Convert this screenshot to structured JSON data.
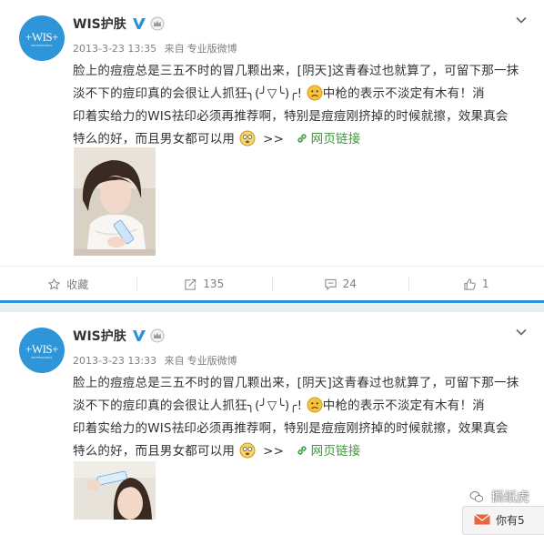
{
  "posts": [
    {
      "author": "WIS护肤",
      "avatar_text": "+WIS+",
      "avatar_sub": "PROFESSIONAL",
      "date": "2013-3-23 13:35",
      "source_prefix": "来自",
      "source": "专业版微博",
      "text_line1": "脸上的痘痘总是三五不时的冒几颗出来，[阴天]这青春过也就算了，可留下那一抹",
      "text_line2_a": "淡不下的痘印真的会很让人抓狂╮(╯▽╰)╭!",
      "text_line2_b": "中枪的表示不淡定有木有！消",
      "text_line3": "印着实给力的WIS祛印必须再推荐啊，特别是痘痘刚挤掉的时候就擦，效果真会",
      "text_line4": "特么的好，而且男女都可以用",
      "more": ">>",
      "link_text": "网页链接",
      "actions": {
        "favorite": "收藏",
        "repost": "135",
        "comment": "24",
        "like": "1"
      }
    },
    {
      "author": "WIS护肤",
      "avatar_text": "+WIS+",
      "avatar_sub": "PROFESSIONAL",
      "date": "2013-3-23 13:33",
      "source_prefix": "来自",
      "source": "专业版微博",
      "text_line1": "脸上的痘痘总是三五不时的冒几颗出来，[阴天]这青春过也就算了，可留下那一抹",
      "text_line2_a": "淡不下的痘印真的会很让人抓狂╮(╯▽╰)╭!",
      "text_line2_b": "中枪的表示不淡定有木有！消",
      "text_line3": "印着实给力的WIS祛印必须再推荐啊，特别是痘痘刚挤掉的时候就擦，效果真会",
      "text_line4": "特么的好，而且男女都可以用",
      "more": ">>",
      "link_text": "网页链接"
    }
  ],
  "watermark": "撕纸虎",
  "notification": "你有5",
  "colors": {
    "accent_blue": "#2d8fd8",
    "link_green": "#3c9a3c",
    "meta_gray": "#808080"
  }
}
